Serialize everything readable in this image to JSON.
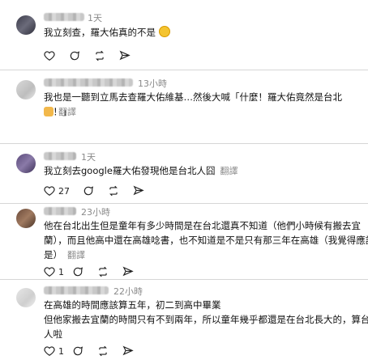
{
  "posts": [
    {
      "time": "1天",
      "text": "我立刻查，羅大佑真的不是",
      "emoji": "smile-emoji"
    },
    {
      "time": "13小時",
      "text": "我也是一聽到立馬去查羅大佑維基…然後大喊「什麼！羅大佑竟然是台北人！」",
      "translate": "翻譯"
    },
    {
      "time": "1天",
      "text": "我立刻去google羅大佑發現他是台北人囧",
      "translate": "翻譯",
      "like_count": "27"
    },
    {
      "time": "23小時",
      "line1": "他在台北出生但是童年有多少時間是在台北還真不知道（他們小時候有搬去宜",
      "line2": "蘭），而且他高中還在高雄唸書，也不知道是不是只有那三年在高雄（我覺得應該",
      "line3": "是）",
      "translate": "翻譯",
      "like_count": "1"
    },
    {
      "time": "22小時",
      "line1": "在高雄的時間應該算五年，初二到高中畢業",
      "line2": "但他家搬去宜蘭的時間只有不到兩年，所以童年幾乎都還是在台北長大的，算台北",
      "line3": "人啦",
      "translate": "翻譯",
      "like_count": "1"
    }
  ],
  "icons": {
    "like": "heart-icon",
    "comment": "comment-icon",
    "repost": "repost-icon",
    "share": "share-icon"
  }
}
